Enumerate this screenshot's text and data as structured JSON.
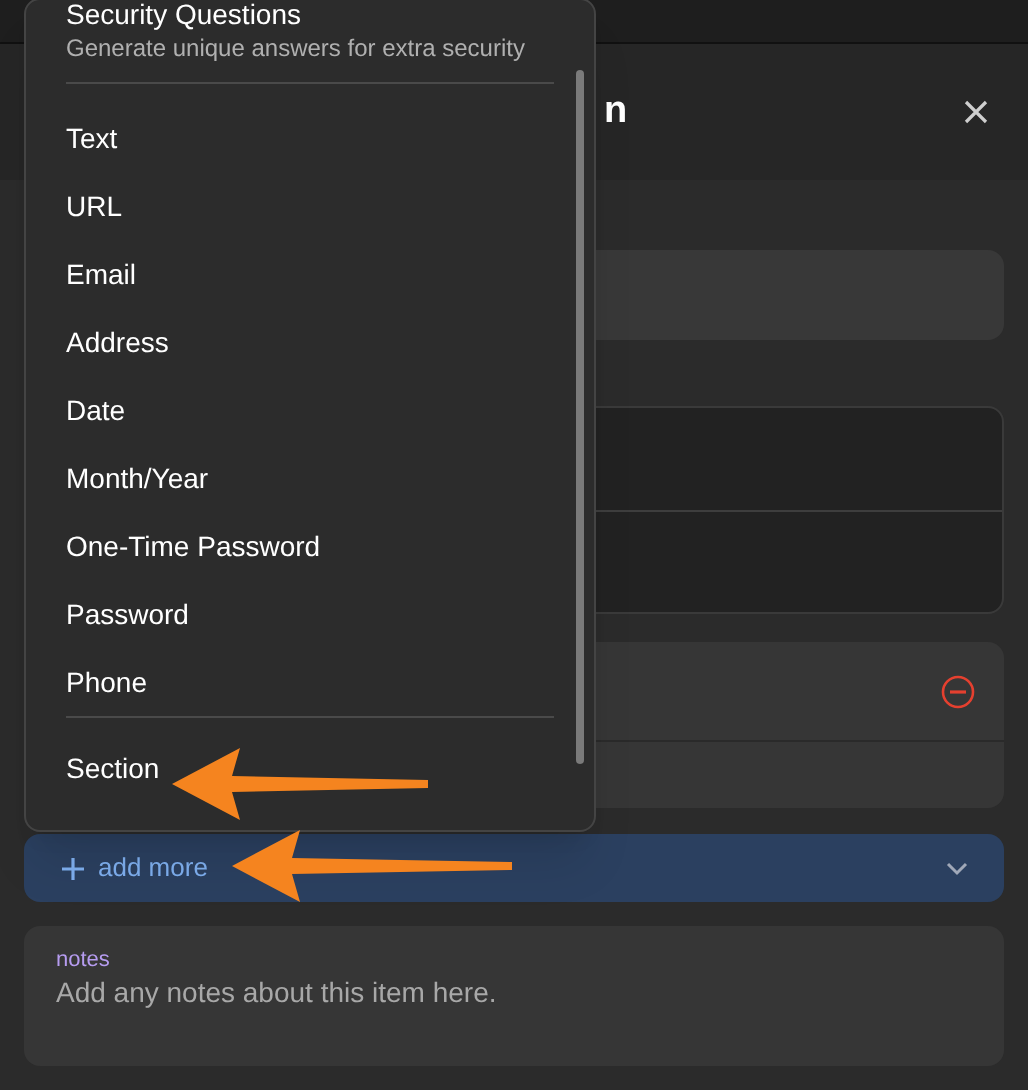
{
  "dialog": {
    "title": "n"
  },
  "menu": {
    "groups": [
      [
        {
          "label": "Security Questions",
          "description": "Generate unique answers for extra security"
        }
      ],
      [
        {
          "label": "Text"
        },
        {
          "label": "URL"
        },
        {
          "label": "Email"
        },
        {
          "label": "Address"
        },
        {
          "label": "Date"
        },
        {
          "label": "Month/Year"
        },
        {
          "label": "One-Time Password"
        },
        {
          "label": "Password"
        },
        {
          "label": "Phone"
        }
      ],
      [
        {
          "label": "Section"
        }
      ]
    ]
  },
  "add_more": {
    "label": "add more"
  },
  "notes": {
    "label": "notes",
    "placeholder": "Add any notes about this item here."
  }
}
